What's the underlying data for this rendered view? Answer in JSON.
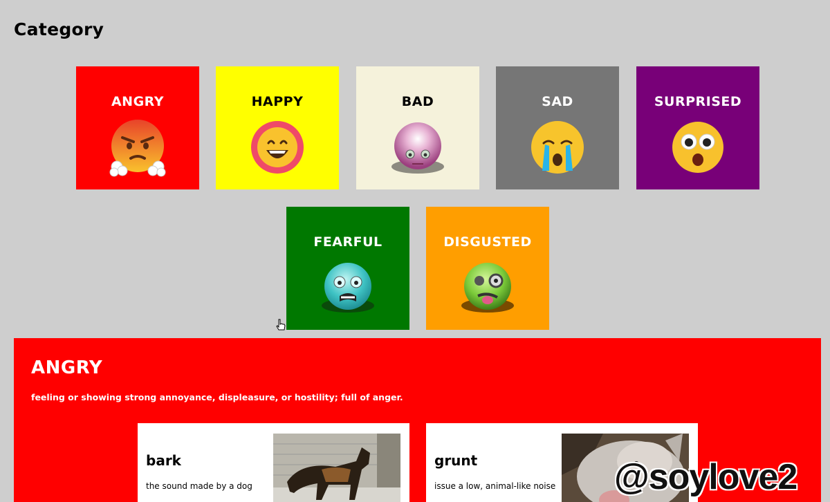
{
  "page": {
    "title": "Category"
  },
  "categories": [
    {
      "label": "ANGRY",
      "color": "#ff0000",
      "text_color": "#ffffff",
      "icon": "angry-face-icon"
    },
    {
      "label": "HAPPY",
      "color": "#ffff00",
      "text_color": "#000000",
      "icon": "happy-face-icon"
    },
    {
      "label": "BAD",
      "color": "#f5f2db",
      "text_color": "#000000",
      "icon": "bad-face-icon"
    },
    {
      "label": "SAD",
      "color": "#767676",
      "text_color": "#ffffff",
      "icon": "crying-face-icon"
    },
    {
      "label": "SURPRISED",
      "color": "#780078",
      "text_color": "#ffffff",
      "icon": "surprised-face-icon"
    },
    {
      "label": "FEARFUL",
      "color": "#007800",
      "text_color": "#ffffff",
      "icon": "fearful-face-icon"
    },
    {
      "label": "DISGUSTED",
      "color": "#ff9e00",
      "text_color": "#ffffff",
      "icon": "disgusted-face-icon"
    }
  ],
  "detail": {
    "title": "ANGRY",
    "description": "feeling or showing strong annoyance, displeasure, or hostility; full of anger.",
    "color": "#ff0000",
    "cards": [
      {
        "word": "bark",
        "definition": "the sound made by a dog",
        "image": "dog-photo"
      },
      {
        "word": "grunt",
        "definition": "issue a low, animal-like noise",
        "image": "pig-photo"
      }
    ]
  },
  "watermark": "@soylove2"
}
